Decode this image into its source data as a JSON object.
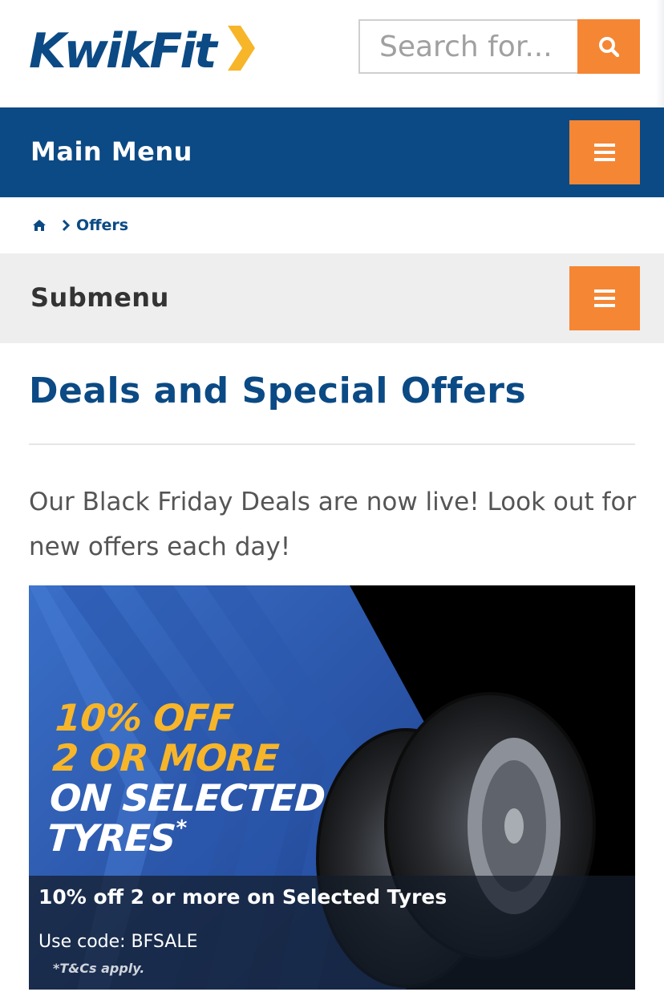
{
  "header": {
    "logo_text": "KwikFit",
    "search": {
      "placeholder": "Search for..."
    }
  },
  "main_menu": {
    "label": "Main Menu"
  },
  "breadcrumb": {
    "items": [
      "Offers"
    ]
  },
  "submenu": {
    "label": "Submenu"
  },
  "content": {
    "title": "Deals and Special Offers",
    "intro": "Our Black Friday Deals are now live! Look out for new offers each day!"
  },
  "banner": {
    "promo_lines": [
      "10% OFF",
      "2 OR MORE",
      "ON SELECTED",
      "TYRES"
    ],
    "promo_asterisk": "*",
    "caption_title": "10% off 2 or more on Selected Tyres",
    "caption_code": "Use code: BFSALE",
    "terms": "*T&Cs apply."
  },
  "colors": {
    "brand_blue": "#0b4a84",
    "accent_orange": "#f58634",
    "promo_yellow": "#f7b52a"
  },
  "icons": [
    "search-icon",
    "hamburger-icon",
    "home-icon",
    "chevron-right-icon"
  ]
}
